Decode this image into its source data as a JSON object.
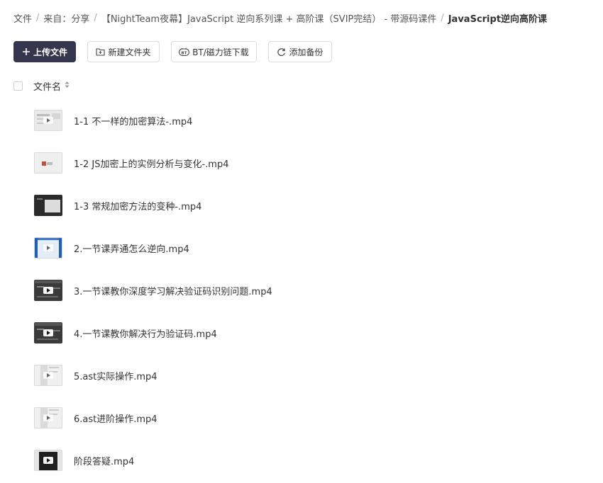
{
  "breadcrumb": [
    {
      "label": "文件",
      "current": false
    },
    {
      "label": "来自：分享",
      "current": false
    },
    {
      "label": "【NightTeam夜幕】JavaScript 逆向系列课 + 高阶课（SVIP完结）  - 带源码课件",
      "current": false
    },
    {
      "label": "JavaScript逆向高阶课",
      "current": true
    }
  ],
  "breadcrumb_separator": "/",
  "toolbar": {
    "upload_label": "上传文件",
    "new_folder_label": "新建文件夹",
    "bt_label": "BT/磁力链下载",
    "backup_label": "添加备份"
  },
  "list_header": {
    "name_column": "文件名"
  },
  "icons": {
    "upload": "plus-icon",
    "new_folder": "folder-plus-icon",
    "bt": "bt-icon",
    "backup": "refresh-icon",
    "sort": "sort-icon"
  },
  "colors": {
    "primary_button": "#33364d",
    "text": "#333333"
  },
  "files": [
    {
      "name": "1-1 不一样的加密算法-.mp4",
      "thumb": "light"
    },
    {
      "name": "1-2 JS加密上的实例分析与变化-.mp4",
      "thumb": "plain"
    },
    {
      "name": "1-3 常规加密方法的变种-.mp4",
      "thumb": "dark"
    },
    {
      "name": "2.一节课弄通怎么逆向.mp4",
      "thumb": "blue"
    },
    {
      "name": "3.一节课教你深度学习解决验证码识别问题.mp4",
      "thumb": "ide"
    },
    {
      "name": "4.一节课教你解决行为验证码.mp4",
      "thumb": "ide"
    },
    {
      "name": "5.ast实际操作.mp4",
      "thumb": "ast"
    },
    {
      "name": "6.ast进阶操作.mp4",
      "thumb": "ast"
    },
    {
      "name": "阶段答疑.mp4",
      "thumb": "qa"
    }
  ]
}
